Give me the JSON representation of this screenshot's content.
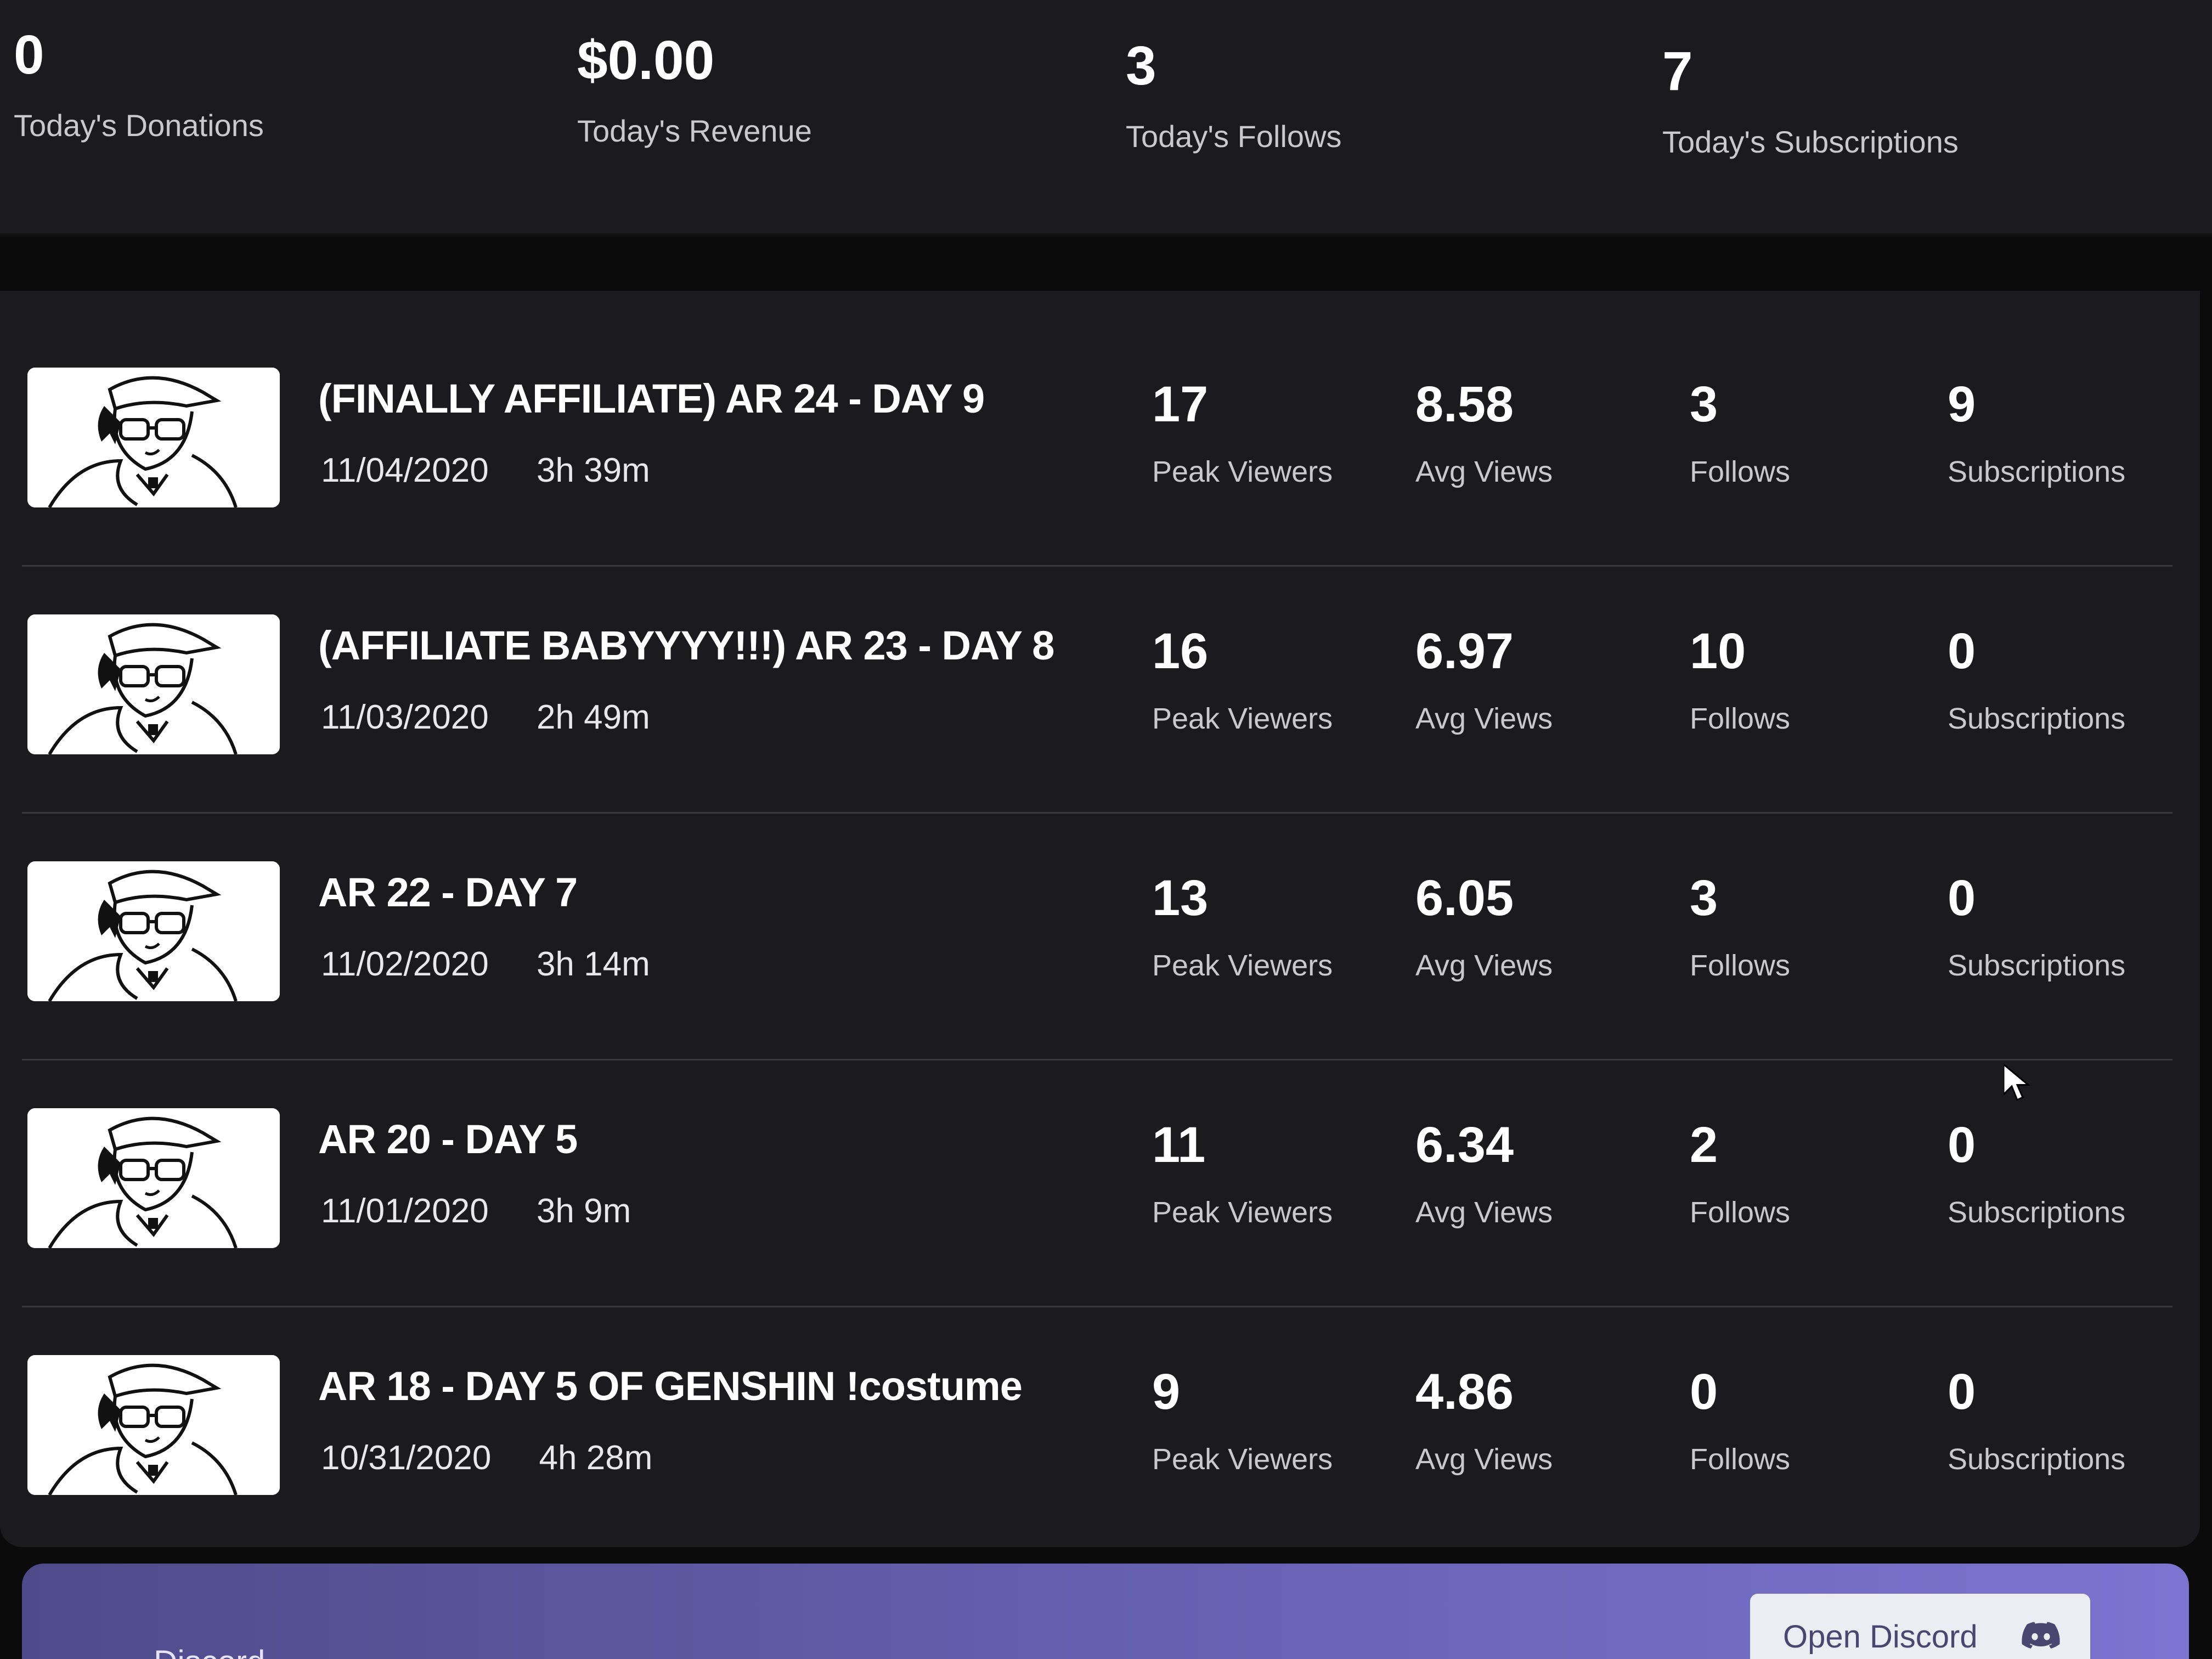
{
  "summary": {
    "donations": {
      "value": "0",
      "label": "Today's Donations"
    },
    "revenue": {
      "value": "$0.00",
      "label": "Today's Revenue"
    },
    "follows": {
      "value": "3",
      "label": "Today's Follows"
    },
    "subscriptions": {
      "value": "7",
      "label": "Today's Subscriptions"
    }
  },
  "labels": {
    "peak_viewers": "Peak Viewers",
    "avg_views": "Avg Views",
    "follows": "Follows",
    "subscriptions": "Subscriptions"
  },
  "streams": [
    {
      "title": "(FINALLY AFFILIATE) AR 24 - DAY 9",
      "date": "11/04/2020",
      "duration": "3h 39m",
      "peak_viewers": "17",
      "avg_views": "8.58",
      "follows": "3",
      "subscriptions": "9"
    },
    {
      "title": "(AFFILIATE BABYYYY!!!) AR 23 - DAY 8",
      "date": "11/03/2020",
      "duration": "2h 49m",
      "peak_viewers": "16",
      "avg_views": "6.97",
      "follows": "10",
      "subscriptions": "0"
    },
    {
      "title": "AR 22 - DAY 7",
      "date": "11/02/2020",
      "duration": "3h 14m",
      "peak_viewers": "13",
      "avg_views": "6.05",
      "follows": "3",
      "subscriptions": "0"
    },
    {
      "title": "AR 20 - DAY 5",
      "date": "11/01/2020",
      "duration": "3h 9m",
      "peak_viewers": "11",
      "avg_views": "6.34",
      "follows": "2",
      "subscriptions": "0"
    },
    {
      "title": "AR 18 - DAY 5 OF GENSHIN !costume",
      "date": "10/31/2020",
      "duration": "4h 28m",
      "peak_viewers": "9",
      "avg_views": "4.86",
      "follows": "0",
      "subscriptions": "0"
    }
  ],
  "discord": {
    "text": "Discord",
    "button_label": "Open Discord",
    "icon": "discord-icon"
  },
  "colors": {
    "background": "#0b0b0c",
    "panel": "#1b1b1d",
    "discord_accent": "#6a63b6"
  }
}
